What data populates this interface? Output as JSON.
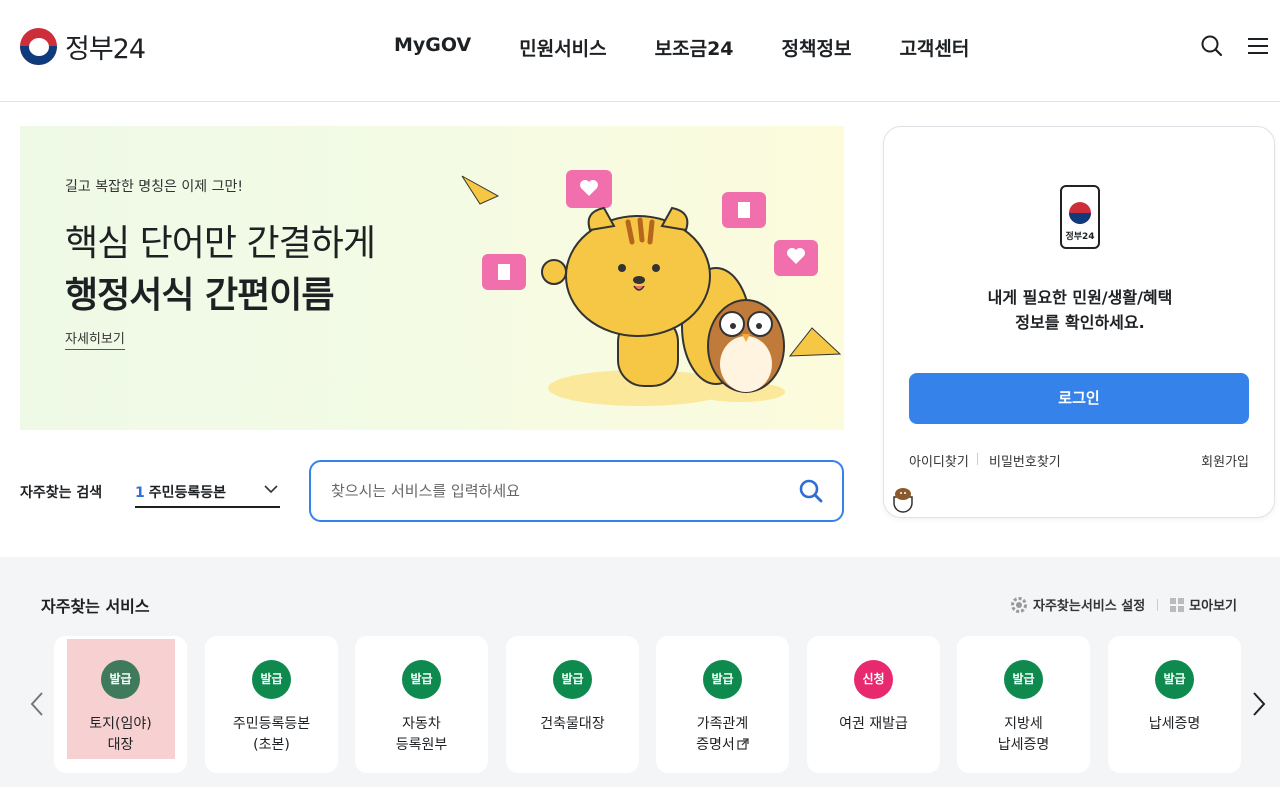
{
  "header": {
    "logo_text": "정부24",
    "nav": [
      "MyGOV",
      "민원서비스",
      "보조금24",
      "정책정보",
      "고객센터"
    ],
    "icons": [
      "search-icon",
      "menu-icon"
    ]
  },
  "banner": {
    "subtitle": "길고 복잡한 명칭은 이제 그만!",
    "title_line1": "핵심 단어만 간결하게",
    "title_line2": "행정서식 간편이름",
    "link": "자세히보기"
  },
  "login": {
    "phone_label": "정부24",
    "message_line1": "내게 필요한 민원/생활/혜택",
    "message_line2": "정보를 확인하세요.",
    "button": "로그인",
    "find_id": "아이디찾기",
    "find_pw": "비밀번호찾기",
    "signup": "회원가입"
  },
  "search": {
    "label": "자주찾는 검색",
    "select_num": "1",
    "select_value": "주민등록등본",
    "placeholder": "찾으시는 서비스를 입력하세요"
  },
  "services": {
    "title": "자주찾는 서비스",
    "settings_label": "자주찾는서비스 설정",
    "view_all_label": "모아보기",
    "colors": {
      "issue": "#0e8a4f",
      "issue_dim": "#3f7a5d",
      "apply": "#e8296f"
    },
    "items": [
      {
        "badge": "발급",
        "label": "토지(임야)\n대장"
      },
      {
        "badge": "발급",
        "label": "주민등록등본\n(초본)"
      },
      {
        "badge": "발급",
        "label": "자동차\n등록원부"
      },
      {
        "badge": "발급",
        "label": "건축물대장"
      },
      {
        "badge": "발급",
        "label": "가족관계\n증명서"
      },
      {
        "badge": "신청",
        "label": "여권 재발급"
      },
      {
        "badge": "발급",
        "label": "지방세\n납세증명"
      },
      {
        "badge": "발급",
        "label": "납세증명"
      }
    ]
  }
}
